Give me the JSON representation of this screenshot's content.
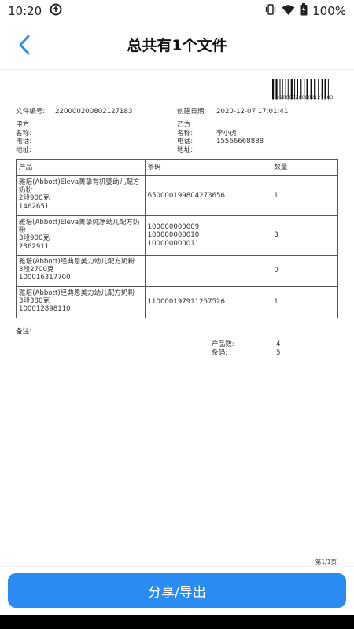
{
  "status_bar": {
    "time": "10:20",
    "battery_text": "100%"
  },
  "header": {
    "title": "总共有1个文件"
  },
  "document": {
    "barcode_number": "220000200802127183",
    "doc_number_label": "文件编号:",
    "doc_number": "220000200802127183",
    "created_label": "创建日期:",
    "created_value": "2020-12-07 17:01:41",
    "party_a": {
      "title": "甲方",
      "name_label": "名称:",
      "phone_label": "电话:",
      "address_label": "地址:"
    },
    "party_b": {
      "title": "乙方",
      "name_label": "名称:",
      "name": "李小虎",
      "phone_label": "电话:",
      "phone": "15566668888",
      "address_label": "地址:"
    },
    "table": {
      "headers": [
        "产品",
        "条码",
        "数量"
      ],
      "rows": [
        {
          "product": [
            "雅培(Abbott)Eleva菁挚有机婴幼儿配方",
            "奶粉",
            "2段900克",
            "1462651"
          ],
          "barcodes": [
            "650000199804273656"
          ],
          "qty": "1"
        },
        {
          "product": [
            "雅培(Abbott)Eleva菁挚纯净幼儿配方奶",
            "粉",
            "3段900克",
            "2362911"
          ],
          "barcodes": [
            "100000000009",
            "100000000010",
            "100000000011"
          ],
          "qty": "3"
        },
        {
          "product": [
            "雅培(Abbott)经典恩美力幼儿配方奶粉",
            "3段2700克",
            "100016317700"
          ],
          "barcodes": [],
          "qty": "0"
        },
        {
          "product": [
            "雅培(Abbott)经典恩美力幼儿配方奶粉",
            "3段380克",
            "100012898110"
          ],
          "barcodes": [
            "110000197911257526"
          ],
          "qty": "1"
        }
      ]
    },
    "remark_label": "备注:",
    "summary": {
      "product_count_label": "产品数:",
      "product_count": "4",
      "barcode_count_label": "条码:",
      "barcode_count": "5"
    },
    "page_number": "第1/1页"
  },
  "footer": {
    "share_label": "分享/导出"
  },
  "colors": {
    "accent": "#2a8cf0",
    "back_icon": "#2a8cf0"
  }
}
